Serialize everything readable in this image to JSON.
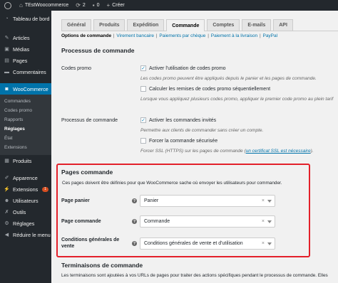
{
  "adminbar": {
    "site_name": "TEstWoocommerce",
    "updates_count": "2",
    "comments_count": "0",
    "new_label": "Créer"
  },
  "sidebar": {
    "dashboard": "Tableau de bord",
    "items_top": [
      {
        "label": "Articles",
        "icon": "pin-icon"
      },
      {
        "label": "Médias",
        "icon": "media-icon"
      },
      {
        "label": "Pages",
        "icon": "pages-icon"
      },
      {
        "label": "Commentaires",
        "icon": "comments-icon"
      }
    ],
    "woocommerce": "WooCommerce",
    "woo_sub": [
      "Commandes",
      "Codes promo",
      "Rapports",
      "Réglages",
      "État",
      "Extensions"
    ],
    "woo_active": "Réglages",
    "produits": "Produits",
    "items_bottom": [
      {
        "label": "Apparence",
        "icon": "brush-icon"
      },
      {
        "label": "Extensions",
        "icon": "plugin-icon",
        "badge": "1"
      },
      {
        "label": "Utilisateurs",
        "icon": "users-icon"
      },
      {
        "label": "Outils",
        "icon": "tools-icon"
      },
      {
        "label": "Réglages",
        "icon": "settings-icon"
      },
      {
        "label": "Réduire le menu",
        "icon": "collapse-icon"
      }
    ]
  },
  "tabs": [
    "Général",
    "Produits",
    "Expédition",
    "Commande",
    "Comptes",
    "E-mails",
    "API"
  ],
  "active_tab": "Commande",
  "subnav": {
    "current": "Options de commande",
    "links": [
      "Virement bancaire",
      "Paiements par chèque",
      "Paiement à la livraison",
      "PayPal"
    ]
  },
  "process": {
    "heading": "Processus de commande",
    "promo_label": "Codes promo",
    "promo_enable": "Activer l'utilisation de codes promo",
    "promo_enable_desc": "Les codes promo peuvent être appliqués depuis le panier et les pages de commande.",
    "promo_seq": "Calculer les remises de codes promo séquentiellement",
    "promo_seq_desc": "Lorsque vous appliquez plusieurs codes promo, appliquer le premier code promo au plein tarif",
    "checkout_label": "Processus de commande",
    "guest": "Activer les commandes invités",
    "guest_desc": "Permettre aux clients de commander sans créer un compte.",
    "secure": "Forcer la commande sécurisée",
    "secure_desc": "Forcer SSL (HTTPS) sur les pages de commande (",
    "secure_link": "un certificat SSL est nécessaire",
    "secure_end": ")."
  },
  "pages": {
    "heading": "Pages commande",
    "desc": "Ces pages doivent être définies pour que WooCommerce sache où envoyer les utilisateurs pour commander.",
    "cart_label": "Page panier",
    "cart_value": "Panier",
    "checkout_label": "Page commande",
    "checkout_value": "Commande",
    "terms_label_1": "Conditions générales de",
    "terms_label_2": "vente",
    "terms_value": "Conditions générales de vente et d'utilisation",
    "help": "?",
    "clear": "×"
  },
  "endpoints": {
    "heading": "Terminaisons de commande",
    "desc": "Les terminaisons sont ajoutées à vos URLs de pages pour traiter des actions spécifiques pendant le processus de commande. Elles"
  }
}
